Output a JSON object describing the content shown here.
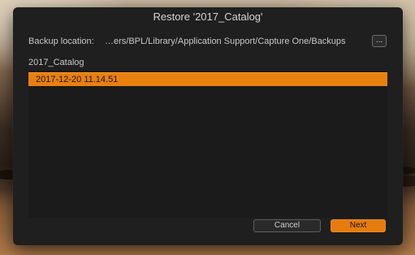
{
  "dialog": {
    "title": "Restore '2017_Catalog'",
    "backup_location_label": "Backup location:",
    "backup_location_path": "…ers/BPL/Library/Application Support/Capture One/Backups",
    "browse_label": "...",
    "catalog_name": "2017_Catalog",
    "backups": [
      {
        "label": "2017-12-20 11.14.51",
        "selected": true
      }
    ],
    "cancel_label": "Cancel",
    "next_label": "Next"
  },
  "colors": {
    "accent": "#e8800f",
    "dialog_background": "#1f1f1f",
    "text": "#c8c8c8"
  }
}
